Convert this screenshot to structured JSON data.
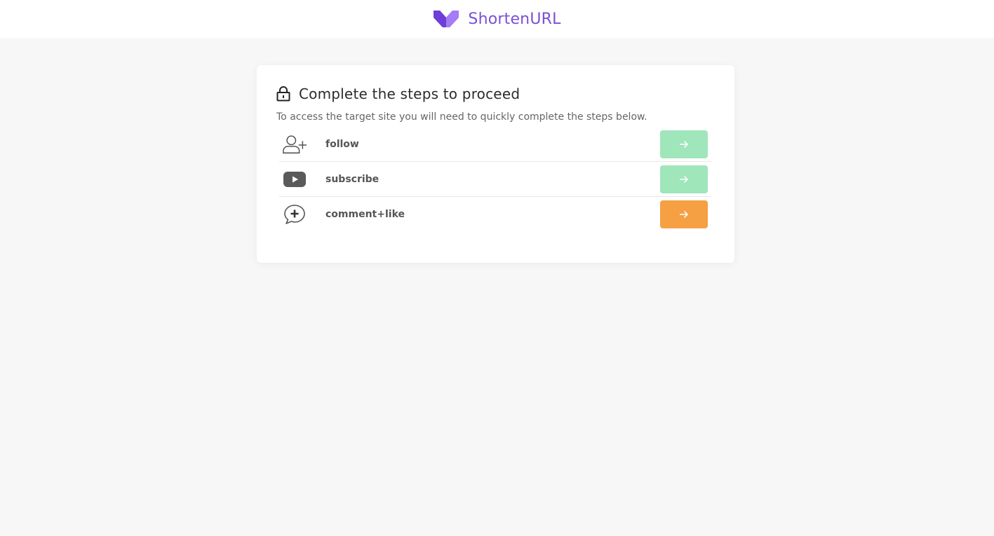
{
  "header": {
    "brand_name": "ShortenURL",
    "logo_icon": "shortenurl-logo-icon",
    "brand_color": "#7b4fd6"
  },
  "card": {
    "title": "Complete the steps to proceed",
    "subtitle": "To access the target site you will need to quickly complete the steps below.",
    "title_icon": "lock-icon"
  },
  "steps": [
    {
      "label": "follow",
      "icon": "user-plus-icon",
      "button_icon": "arrow-right-icon",
      "button_color": "#9fe6bb",
      "status": "done"
    },
    {
      "label": "subscribe",
      "icon": "youtube-play-icon",
      "button_icon": "arrow-right-icon",
      "button_color": "#9fe6bb",
      "status": "done"
    },
    {
      "label": "comment+like",
      "icon": "comment-plus-icon",
      "button_icon": "arrow-right-icon",
      "button_color": "#f5a043",
      "status": "pending"
    }
  ]
}
